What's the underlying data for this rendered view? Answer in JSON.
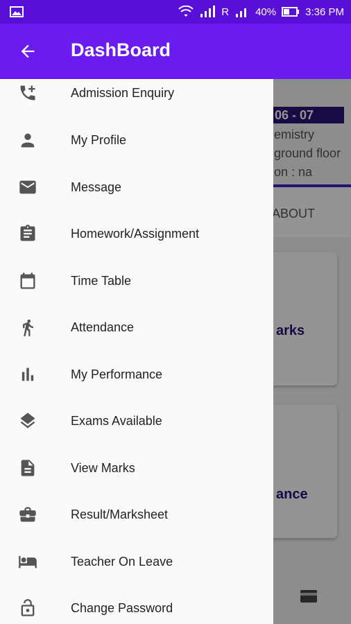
{
  "status_bar": {
    "carrier": "R",
    "battery": "40%",
    "time": "3:36 PM"
  },
  "app_bar": {
    "title": "DashBoard",
    "back_icon": "arrow-left-icon"
  },
  "background": {
    "date_badge": "06 - 07",
    "line1": "emistry",
    "line2": "ground floor",
    "line3": "on : na",
    "tab_about": "ABOUT",
    "card1_label": "arks",
    "card2_label": "ance"
  },
  "drawer": {
    "items": [
      {
        "label": "Admission Enquiry",
        "icon": "phone-add-icon"
      },
      {
        "label": "My Profile",
        "icon": "person-icon"
      },
      {
        "label": "Message",
        "icon": "mail-icon"
      },
      {
        "label": "Homework/Assignment",
        "icon": "clipboard-icon"
      },
      {
        "label": "Time Table",
        "icon": "calendar-icon"
      },
      {
        "label": "Attendance",
        "icon": "walk-icon"
      },
      {
        "label": "My Performance",
        "icon": "bar-chart-icon"
      },
      {
        "label": "Exams Available",
        "icon": "layers-icon"
      },
      {
        "label": "View Marks",
        "icon": "document-icon"
      },
      {
        "label": "Result/Marksheet",
        "icon": "briefcase-icon"
      },
      {
        "label": "Teacher On Leave",
        "icon": "bed-icon"
      },
      {
        "label": "Change Password",
        "icon": "lock-open-icon"
      }
    ]
  }
}
